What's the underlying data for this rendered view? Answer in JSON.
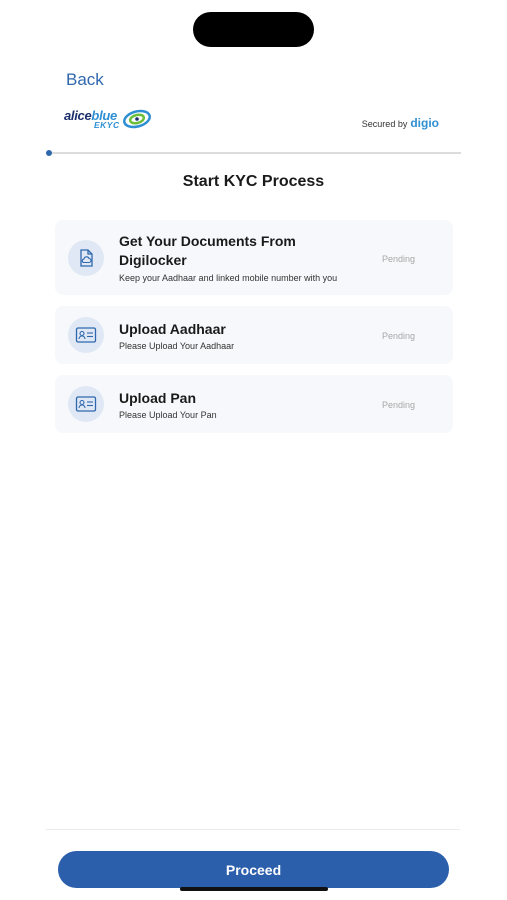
{
  "nav": {
    "back_label": "Back"
  },
  "brand": {
    "logo_text_1": "alice",
    "logo_text_2": "blue",
    "logo_sub": "EKYC",
    "secured_by": "Secured by",
    "partner": "digio"
  },
  "progress": {
    "fraction": 0.0
  },
  "page": {
    "title": "Start KYC Process"
  },
  "steps": [
    {
      "name_line1": "Get Your Documents From",
      "name_line2": "Digilocker",
      "description": "Keep your Aadhaar and linked mobile number with you",
      "status": "Pending",
      "icon": "cloud-document-icon"
    },
    {
      "name_line1": "Upload Aadhaar",
      "description": "Please Upload Your Aadhaar",
      "status": "Pending",
      "icon": "id-card-icon"
    },
    {
      "name_line1": "Upload Pan",
      "description": "Please Upload Your Pan",
      "status": "Pending",
      "icon": "id-card-icon"
    }
  ],
  "footer": {
    "proceed_label": "Proceed"
  },
  "colors": {
    "accent": "#2b5eab",
    "card_bg": "#f6f8fb",
    "pending": "#a7a7a7"
  }
}
